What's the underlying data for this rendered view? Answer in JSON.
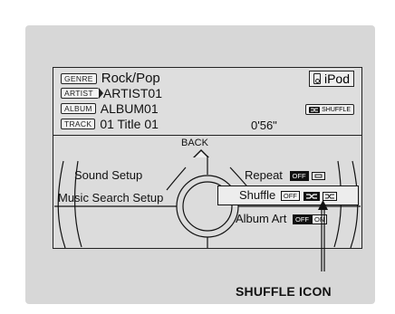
{
  "info": {
    "genre": {
      "tag": "GENRE",
      "value": "Rock/Pop"
    },
    "artist": {
      "tag": "ARTIST",
      "value": "ARTIST01"
    },
    "album": {
      "tag": "ALBUM",
      "value": "ALBUM01"
    },
    "track": {
      "tag": "TRACK",
      "value": "01 Title 01"
    },
    "source": "iPod",
    "shuffle_status": "SHUFFLE",
    "elapsed": "0'56\""
  },
  "back_label": "BACK",
  "menu": {
    "sound_setup": "Sound Setup",
    "music_search_setup": "Music Search Setup",
    "repeat": {
      "label": "Repeat",
      "off": "OFF"
    },
    "shuffle": {
      "label": "Shuffle",
      "off": "OFF"
    },
    "album_art": {
      "label": "Album Art",
      "off": "OFF",
      "on": "ON"
    }
  },
  "caption": "SHUFFLE ICON"
}
